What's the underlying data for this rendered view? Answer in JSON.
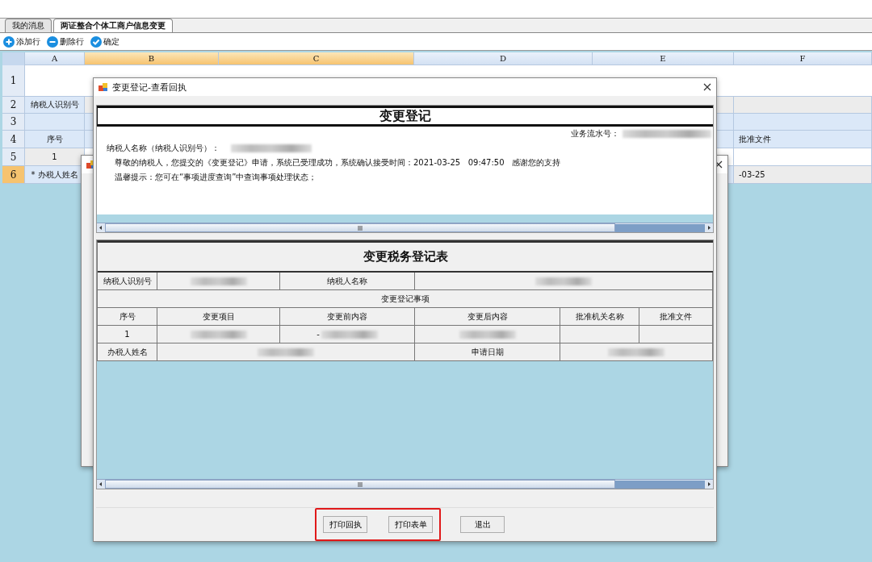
{
  "tabs": [
    {
      "label": "我的消息",
      "selected": false
    },
    {
      "label": "两证整合个体工商户信息变更",
      "selected": true
    }
  ],
  "toolbar": [
    {
      "label": "添加行",
      "kind": "add"
    },
    {
      "label": "删除行",
      "kind": "remove"
    },
    {
      "label": "确定",
      "kind": "confirm"
    }
  ],
  "sheet": {
    "columns": [
      {
        "label": "A",
        "selected": false
      },
      {
        "label": "B",
        "selected": true
      },
      {
        "label": "C",
        "selected": true
      },
      {
        "label": "D",
        "selected": false
      },
      {
        "label": "E",
        "selected": false
      },
      {
        "label": "F",
        "selected": false
      }
    ],
    "rows": [
      {
        "header": "1",
        "selected": false
      },
      {
        "header": "2",
        "selected": false,
        "cells": [
          "纳税人识别号",
          null,
          null,
          null,
          null,
          null
        ]
      },
      {
        "header": "3",
        "selected": false,
        "cells": [
          null,
          null,
          null,
          null,
          null,
          null
        ]
      },
      {
        "header": "4",
        "selected": false,
        "cells": [
          "序号",
          null,
          null,
          null,
          null,
          "批准文件"
        ]
      },
      {
        "header": "5",
        "selected": false,
        "cells": [
          "1",
          null,
          null,
          null,
          null,
          null
        ]
      },
      {
        "header": "6",
        "selected": true,
        "cells": [
          "* 办税人姓名",
          null,
          null,
          null,
          null,
          "-03-25"
        ]
      }
    ]
  },
  "dialog": {
    "title": "变更登记-查看回执",
    "receipt": {
      "heading": "变更登记",
      "serial_label": "业务流水号：",
      "name_label": "纳税人名称（纳税人识别号）：",
      "message": "尊敬的纳税人，您提交的《变更登记》申请，系统已受理成功，系统确认接受时间：2021-03-25   09:47:50   感谢您的支持",
      "hint": "温馨提示：您可在“事项进度查询”中查询事项处理状态；"
    },
    "form": {
      "title": "变更税务登记表",
      "rows": [
        [
          {
            "kind": "label",
            "text": "纳税人识别号"
          },
          {
            "kind": "blurred"
          },
          {
            "kind": "label",
            "text": "纳税人名称"
          },
          {
            "kind": "blurred"
          },
          {
            "kind": "merged"
          },
          {
            "kind": "merged"
          }
        ],
        [
          {
            "kind": "label",
            "text": "变更登记事项"
          },
          {
            "kind": "merged"
          },
          {
            "kind": "merged"
          },
          {
            "kind": "merged"
          },
          {
            "kind": "merged"
          },
          {
            "kind": "merged"
          }
        ],
        [
          {
            "kind": "label",
            "text": "序号"
          },
          {
            "kind": "label",
            "text": "变更项目"
          },
          {
            "kind": "label",
            "text": "变更前内容"
          },
          {
            "kind": "label",
            "text": "变更后内容"
          },
          {
            "kind": "label",
            "text": "批准机关名称"
          },
          {
            "kind": "label",
            "text": "批准文件"
          }
        ],
        [
          {
            "kind": "label",
            "text": "1"
          },
          {
            "kind": "blurred"
          },
          {
            "kind": "blurred",
            "text": "-"
          },
          {
            "kind": "blurred"
          },
          {
            "kind": "empty"
          },
          {
            "kind": "empty"
          }
        ],
        [
          {
            "kind": "label",
            "text": "办税人姓名"
          },
          {
            "kind": "blurred"
          },
          {
            "kind": "merged"
          },
          {
            "kind": "label",
            "text": "申请日期"
          },
          {
            "kind": "blurred"
          },
          {
            "kind": "merged"
          }
        ]
      ]
    },
    "buttons": [
      {
        "label": "打印回执",
        "highlighted": true
      },
      {
        "label": "打印表单",
        "highlighted": true
      },
      {
        "label": "退出",
        "highlighted": false
      }
    ]
  }
}
